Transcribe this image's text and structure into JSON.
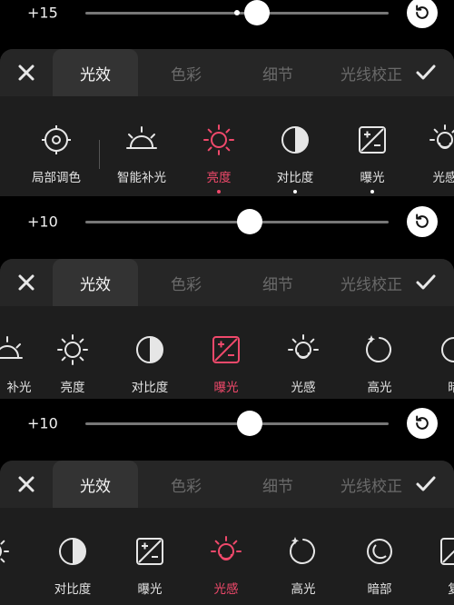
{
  "section1": {
    "slider_value": "+15",
    "slider_level": 0.5,
    "tabs": [
      "光效",
      "色彩",
      "细节",
      "光线校正"
    ],
    "tools": [
      {
        "label": "局部调色",
        "icon": "target-icon"
      },
      {
        "label": "智能补光",
        "icon": "sunrise-icon"
      },
      {
        "label": "亮度",
        "icon": "sun-icon",
        "active": true
      },
      {
        "label": "对比度",
        "icon": "contrast-icon"
      },
      {
        "label": "曝光",
        "icon": "exposure-icon"
      },
      {
        "label": "光感",
        "icon": "light-sense-icon"
      }
    ]
  },
  "section2": {
    "slider_value": "+10",
    "slider_level": 0.5,
    "tabs": [
      "光效",
      "色彩",
      "细节",
      "光线校正"
    ],
    "tools": [
      {
        "label": "补光",
        "icon": "sunrise-icon"
      },
      {
        "label": "亮度",
        "icon": "sun-icon"
      },
      {
        "label": "对比度",
        "icon": "contrast-icon"
      },
      {
        "label": "曝光",
        "icon": "exposure-icon",
        "active": true
      },
      {
        "label": "光感",
        "icon": "light-sense-icon"
      },
      {
        "label": "高光",
        "icon": "highlight-icon"
      },
      {
        "label": "暗",
        "icon": "shadow-icon"
      }
    ]
  },
  "section3": {
    "slider_value": "+10",
    "slider_level": 0.5,
    "tabs": [
      "光效",
      "色彩",
      "细节",
      "光线校正"
    ],
    "tools": [
      {
        "label": "",
        "icon": "sun-icon"
      },
      {
        "label": "对比度",
        "icon": "contrast-icon"
      },
      {
        "label": "曝光",
        "icon": "exposure-icon"
      },
      {
        "label": "光感",
        "icon": "light-sense-icon",
        "active": true
      },
      {
        "label": "高光",
        "icon": "highlight-icon"
      },
      {
        "label": "暗部",
        "icon": "shadow-icon"
      },
      {
        "label": "复",
        "icon": "exposure-icon"
      }
    ]
  },
  "colors": {
    "accent": "#f0496b",
    "icon": "#e6e6e6",
    "tab_inactive": "#6a6a6a"
  }
}
